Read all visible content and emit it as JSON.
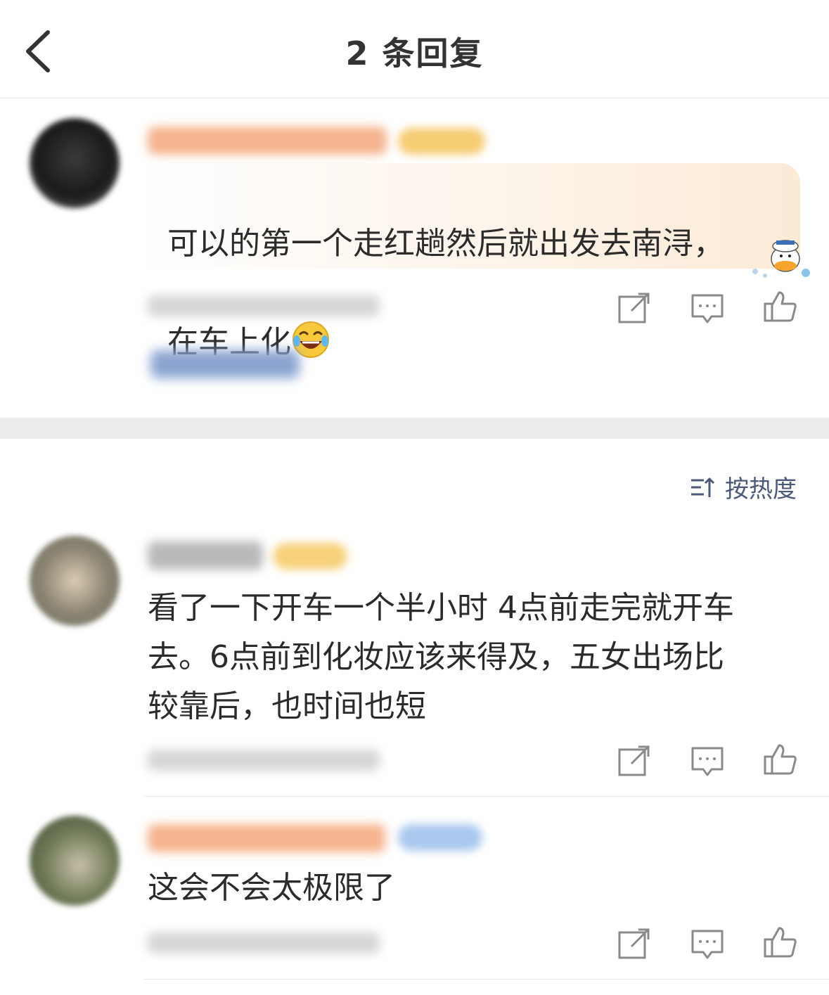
{
  "header": {
    "title": "2 条回复"
  },
  "icons": {
    "back": "chevron-left-icon",
    "share": "share-icon",
    "comment": "comment-icon",
    "like": "thumbs-up-icon",
    "sort": "sort-icon"
  },
  "original_comment": {
    "text_line1": "可以的第一个走红趟然后就出发去南浔，",
    "text_line2": "在车上化"
  },
  "sort": {
    "label": "按热度"
  },
  "replies": [
    {
      "text": "看了一下开车一个半小时 4点前走完就开车\n去。6点前到化妆应该来得及，五女出场比\n较靠后，也时间也短"
    },
    {
      "text": "这会不会太极限了"
    }
  ],
  "colors": {
    "accent_link": "#4a5a78",
    "icon_gray": "#888888",
    "divider": "#ececec"
  }
}
